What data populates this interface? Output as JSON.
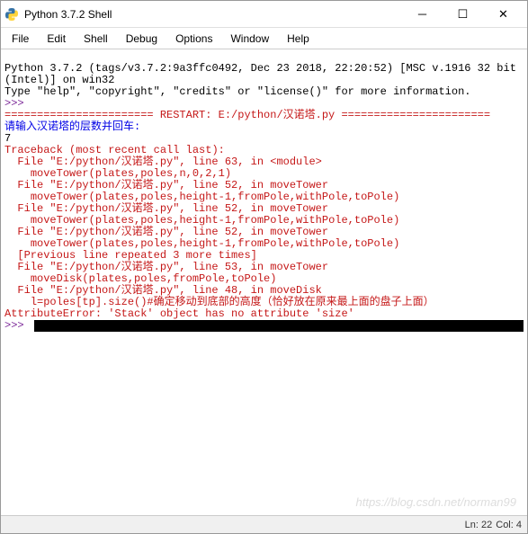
{
  "window": {
    "title": "Python 3.7.2 Shell"
  },
  "menu": {
    "file": "File",
    "edit": "Edit",
    "shell": "Shell",
    "debug": "Debug",
    "options": "Options",
    "window": "Window",
    "help": "Help"
  },
  "content": {
    "header1": "Python 3.7.2 (tags/v3.7.2:9a3ffc0492, Dec 23 2018, 22:20:52) [MSC v.1916 32 bit (Intel)] on win32",
    "header2": "Type \"help\", \"copyright\", \"credits\" or \"license()\" for more information.",
    "prompt1": ">>> ",
    "restart": "======================= RESTART: E:/python/汉诺塔.py =======================",
    "input_prompt": "请输入汉诺塔的层数并回车:",
    "input_value": "7",
    "tb0": "Traceback (most recent call last):",
    "tb1": "  File \"E:/python/汉诺塔.py\", line 63, in <module>",
    "tb2": "    moveTower(plates,poles,n,0,2,1)",
    "tb3": "  File \"E:/python/汉诺塔.py\", line 52, in moveTower",
    "tb4": "    moveTower(plates,poles,height-1,fromPole,withPole,toPole)",
    "tb5": "  File \"E:/python/汉诺塔.py\", line 52, in moveTower",
    "tb6": "    moveTower(plates,poles,height-1,fromPole,withPole,toPole)",
    "tb7": "  File \"E:/python/汉诺塔.py\", line 52, in moveTower",
    "tb8": "    moveTower(plates,poles,height-1,fromPole,withPole,toPole)",
    "tb9": "  [Previous line repeated 3 more times]",
    "tb10": "  File \"E:/python/汉诺塔.py\", line 53, in moveTower",
    "tb11": "    moveDisk(plates,poles,fromPole,toPole)",
    "tb12": "  File \"E:/python/汉诺塔.py\", line 48, in moveDisk",
    "tb13": "    l=poles[tp].size()#确定移动到底部的高度（恰好放在原来最上面的盘子上面）",
    "tb14": "AttributeError: 'Stack' object has no attribute 'size'",
    "prompt2": ">>> "
  },
  "status": {
    "ln": "Ln: 22",
    "col": "Col: 4"
  },
  "watermark": "https://blog.csdn.net/norman99"
}
